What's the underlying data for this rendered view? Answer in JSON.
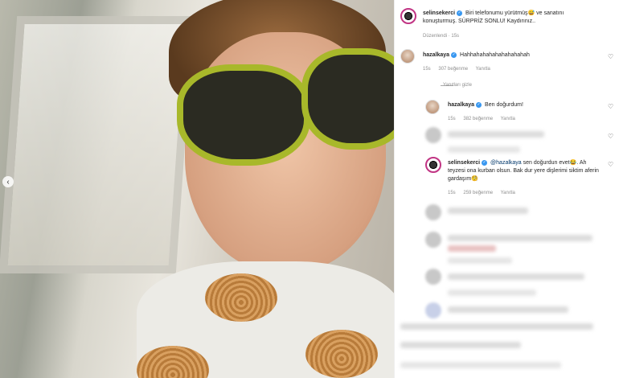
{
  "post": {
    "author": "selinsekerci",
    "caption": "Biri telefonumu yürütmüş😅 ve sanatını konuşturmuş. SÜRPRİZ SONLU! Kaydırınız..",
    "edited": "Düzenlendi · 15s"
  },
  "comments": [
    {
      "user": "hazalkaya",
      "text": "Hahhahahahahahahahahah",
      "time": "15s",
      "likes": "307 beğenme",
      "reply": "Yanıtla",
      "hide_replies": "Yanıtları gizle"
    },
    {
      "user": "hazalkaya",
      "text": "Ben doğurdum!",
      "time": "15s",
      "likes": "382 beğenme",
      "reply": "Yanıtla"
    },
    {
      "user": "selinsekerci",
      "mention": "@hazalkaya",
      "text": " sen doğurdun evet😂. Ah teyzesi ona kurban olsun. Bak dur yere dişlerimi siktim aferin gardaşım🧐",
      "time": "15s",
      "likes": "259 beğenme",
      "reply": "Yanıtla"
    }
  ],
  "icons": {
    "heart": "♡",
    "carousel_prev": "‹",
    "verified": "✓"
  },
  "colors": {
    "verified": "#3897f0",
    "story_ring": "#c13584",
    "mention": "#00376b"
  }
}
